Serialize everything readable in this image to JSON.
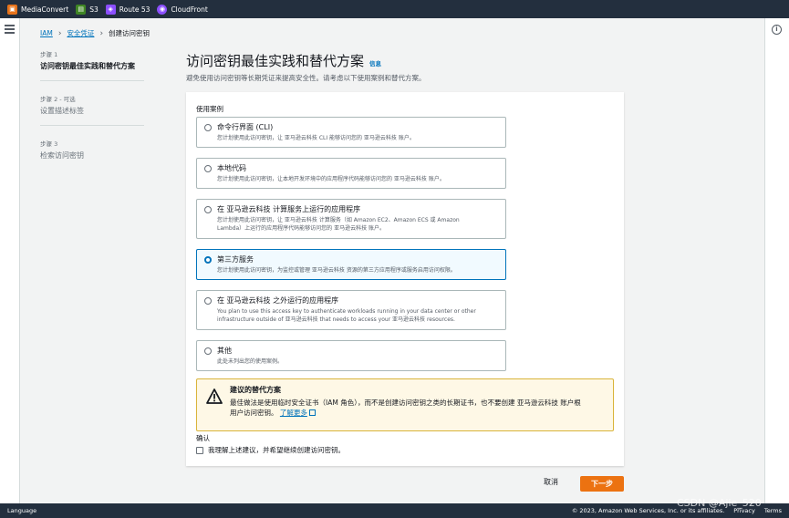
{
  "topbar": {
    "services": [
      {
        "label": "MediaConvert",
        "icon": "mediaconvert-icon",
        "color": "#e7731a"
      },
      {
        "label": "S3",
        "icon": "s3-icon",
        "color": "#3f8624"
      },
      {
        "label": "Route 53",
        "icon": "route53-icon",
        "color": "#8c4fff"
      },
      {
        "label": "CloudFront",
        "icon": "cloudfront-icon",
        "color": "#8c4fff"
      }
    ]
  },
  "breadcrumb": {
    "items": [
      "IAM",
      "安全凭证"
    ],
    "current": "创建访问密钥"
  },
  "steps": [
    {
      "label": "步骤 1",
      "title": "访问密钥最佳实践和替代方案"
    },
    {
      "label": "步骤 2 - 可选",
      "title": "设置描述标签"
    },
    {
      "label": "步骤 3",
      "title": "检索访问密钥"
    }
  ],
  "page": {
    "title": "访问密钥最佳实践和替代方案",
    "info": "信息",
    "description": "避免使用访问密钥等长期凭证来提高安全性。请考虑以下使用案例和替代方案。"
  },
  "use_case": {
    "label": "使用案例",
    "options": [
      {
        "title": "命令行界面 (CLI)",
        "desc": [
          "您计划使用此访问密钥，让 亚马逊云科技 CLI 能够访问您的 亚马逊云科技 账户。"
        ]
      },
      {
        "title": "本地代码",
        "desc": [
          "您计划使用此访问密钥，让本地开发环境中的应用程序代码能够访问您的 亚马逊云科技 账户。"
        ]
      },
      {
        "title": "在 亚马逊云科技 计算服务上运行的应用程序",
        "desc": [
          "您计划使用此访问密钥，让 亚马逊云科技 计算服务（如 Amazon EC2、Amazon ECS 或 Amazon",
          "Lambda）上运行的应用程序代码能够访问您的 亚马逊云科技 账户。"
        ]
      },
      {
        "title": "第三方服务",
        "desc": [
          "您计划使用此访问密钥，为监控或管理 亚马逊云科技 资源的第三方应用程序或服务启用访问权限。"
        ]
      },
      {
        "title": "在 亚马逊云科技 之外运行的应用程序",
        "desc": [
          "You plan to use this access key to authenticate workloads running in your data center or other",
          "infrastructure outside of 亚马逊云科技 that needs to access your 亚马逊云科技 resources."
        ]
      },
      {
        "title": "其他",
        "desc": [
          "此处未列出您的使用案例。"
        ]
      }
    ],
    "selected_index": 3
  },
  "alert": {
    "title": "建议的替代方案",
    "body_line1": "最佳做法是使用临时安全证书（IAM 角色），而不是创建访问密钥之类的长期证书，也不要创建 亚马逊云科技 账户根",
    "body_line2": "用户访问密钥。",
    "link": "了解更多"
  },
  "confirm": {
    "label": "确认",
    "checkbox_text": "我理解上述建议，并希望继续创建访问密钥。",
    "checked": false
  },
  "actions": {
    "cancel": "取消",
    "next": "下一步"
  },
  "footer": {
    "language": "Language",
    "copyright": "© 2023, Amazon Web Services, Inc. or its affiliates.",
    "privacy": "Privacy",
    "terms": "Terms"
  },
  "watermark": "CSDN @Ajie_520",
  "colors": {
    "accent": "#0073bb",
    "primary_button": "#ec7211",
    "header": "#232f3e",
    "alert_bg": "#fef8e6"
  }
}
